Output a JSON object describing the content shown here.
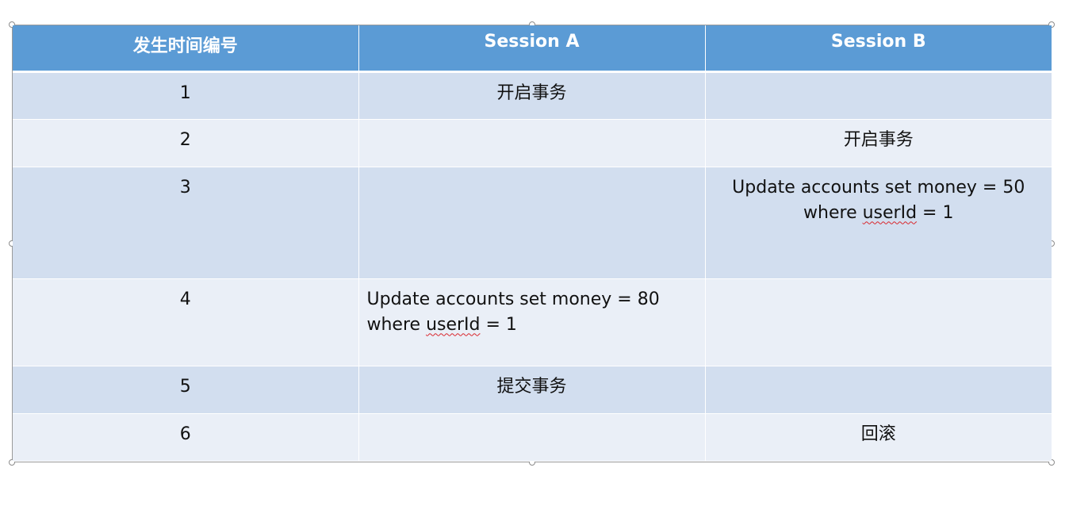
{
  "table": {
    "headers": [
      "发生时间编号",
      "Session A",
      "Session B"
    ],
    "rows": [
      {
        "num": "1",
        "a": "开启事务",
        "b": ""
      },
      {
        "num": "2",
        "a": "",
        "b": "开启事务"
      },
      {
        "num": "3",
        "a": "",
        "b_line1": "Update accounts  set money = 50",
        "b_line2_prefix": "where ",
        "b_line2_word": "userId",
        "b_line2_suffix": " = 1"
      },
      {
        "num": "4",
        "a_line1": "Update accounts  set money = 80",
        "a_line2_prefix": "where ",
        "a_line2_word": "userId",
        "a_line2_suffix": " = 1",
        "b": ""
      },
      {
        "num": "5",
        "a": "提交事务",
        "b": ""
      },
      {
        "num": "6",
        "a": "",
        "b": "回滚"
      }
    ]
  },
  "colors": {
    "header_bg": "#5b9bd5",
    "row_dark": "#d2deef",
    "row_light": "#eaeff7",
    "spell_check": "#d9262c"
  }
}
